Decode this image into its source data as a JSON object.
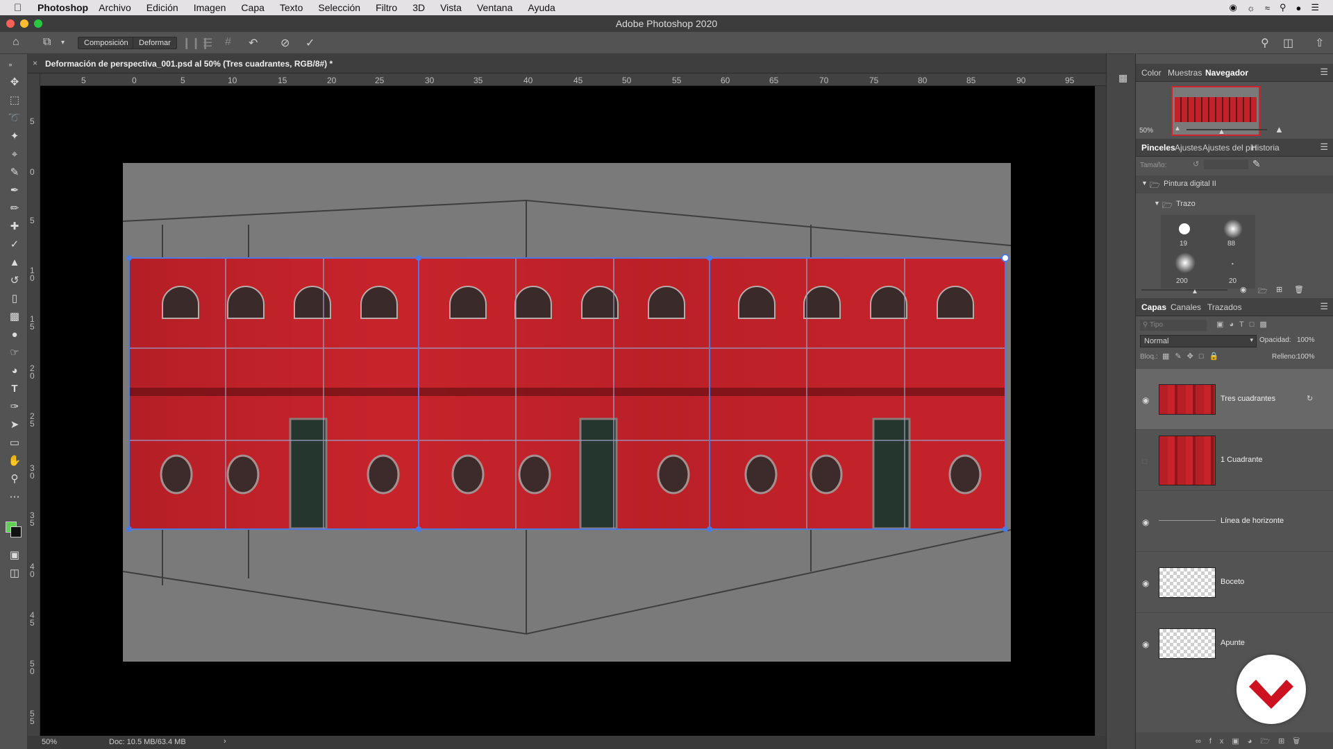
{
  "menubar": {
    "app_name": "Photoshop",
    "items": [
      "Archivo",
      "Edición",
      "Imagen",
      "Capa",
      "Texto",
      "Selección",
      "Filtro",
      "3D",
      "Vista",
      "Ventana",
      "Ayuda"
    ]
  },
  "window": {
    "title": "Adobe Photoshop 2020"
  },
  "options_bar": {
    "composition_label": "Composición",
    "deform_label": "Deformar"
  },
  "document": {
    "tab_title": "Deformación de perspectiva_001.psd al 50% (Tres cuadrantes, RGB/8#) *",
    "zoom": "50%",
    "doc_size": "Doc: 10.5 MB/63.4 MB"
  },
  "ruler": {
    "h_labels": [
      "5",
      "0",
      "5",
      "10",
      "15",
      "20",
      "25",
      "30",
      "35",
      "40",
      "45",
      "50",
      "55",
      "60",
      "65",
      "70",
      "75",
      "80",
      "85",
      "90",
      "95"
    ],
    "v_labels": [
      "5",
      "0",
      "5",
      "1\n0",
      "1\n5",
      "2\n0",
      "2\n5",
      "3\n0",
      "3\n5",
      "4\n0",
      "4\n5",
      "5\n0",
      "5\n5"
    ]
  },
  "navigator_panel": {
    "tabs": [
      "Color",
      "Muestras",
      "Navegador"
    ],
    "active_tab": "Navegador",
    "zoom": "50%"
  },
  "brushes_panel": {
    "tabs": [
      "Pinceles",
      "Ajustes",
      "Ajustes del pin",
      "Historia"
    ],
    "active_tab": "Pinceles",
    "size_label": "Tamaño:",
    "group_name": "Pintura digital II",
    "subgroup_name": "Trazo",
    "brush_sizes": [
      "19",
      "88",
      "200",
      "20"
    ]
  },
  "layers_panel": {
    "tabs": [
      "Capas",
      "Canales",
      "Trazados"
    ],
    "active_tab": "Capas",
    "filter_placeholder": "Tipo",
    "blend_mode": "Normal",
    "opacity_label": "Opacidad:",
    "opacity_value": "100%",
    "lock_label": "Bloq.:",
    "fill_label": "Relleno:",
    "fill_value": "100%",
    "layers": [
      {
        "name": "Tres cuadrantes",
        "visible": true,
        "selected": true
      },
      {
        "name": "1 Cuadrante",
        "visible": false,
        "selected": false
      },
      {
        "name": "Línea de horizonte",
        "visible": true,
        "selected": false
      },
      {
        "name": "Boceto",
        "visible": true,
        "selected": false
      },
      {
        "name": "Apunte",
        "visible": true,
        "selected": false
      }
    ]
  },
  "colors": {
    "foreground": "#5fcf55",
    "background": "#111111",
    "accent_red": "#d0232c",
    "logo_red": "#cc1220"
  },
  "icons": {
    "move": "move-icon",
    "marquee": "marquee-icon",
    "lasso": "lasso-icon",
    "wand": "magic-wand-icon",
    "crop": "crop-icon",
    "eyedropper": "eyedropper-icon"
  }
}
